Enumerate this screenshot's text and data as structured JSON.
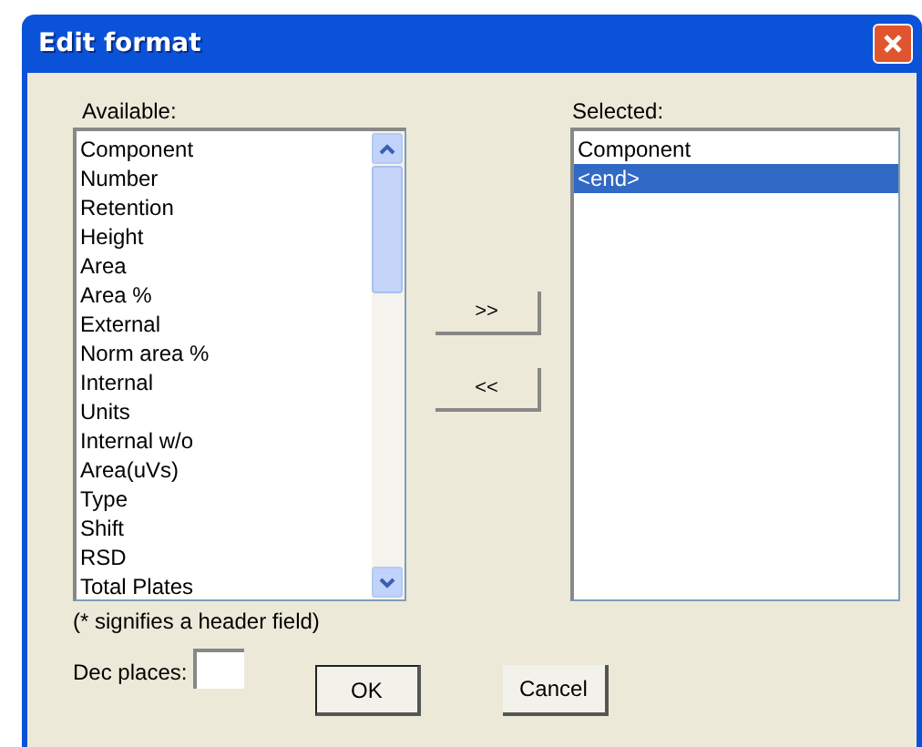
{
  "window": {
    "title": "Edit format"
  },
  "available": {
    "label": "Available:",
    "items": [
      {
        "text": "Component",
        "selected": false
      },
      {
        "text": "Number",
        "selected": false
      },
      {
        "text": "Retention",
        "selected": false
      },
      {
        "text": "Height",
        "selected": false
      },
      {
        "text": "Area",
        "selected": false
      },
      {
        "text": "Area %",
        "selected": false
      },
      {
        "text": "External",
        "selected": false
      },
      {
        "text": "Norm area %",
        "selected": false
      },
      {
        "text": "Internal",
        "selected": false
      },
      {
        "text": "Units",
        "selected": false
      },
      {
        "text": "Internal w/o",
        "selected": false
      },
      {
        "text": "Area(uVs)",
        "selected": false
      },
      {
        "text": "Type",
        "selected": false
      },
      {
        "text": "Shift",
        "selected": false
      },
      {
        "text": "RSD",
        "selected": false
      },
      {
        "text": "Total Plates",
        "selected": false
      }
    ]
  },
  "move_buttons": [
    ">>",
    "<<"
  ],
  "selected": {
    "label": "Selected:",
    "items": [
      {
        "text": "Component",
        "selected": false
      },
      {
        "text": "<end>",
        "selected": true
      }
    ]
  },
  "note": "(* signifies a header field)",
  "dec_places": {
    "label": "Dec places:"
  },
  "buttons": [
    {
      "label": "OK",
      "default": true
    },
    {
      "label": "Cancel",
      "default": false
    }
  ]
}
